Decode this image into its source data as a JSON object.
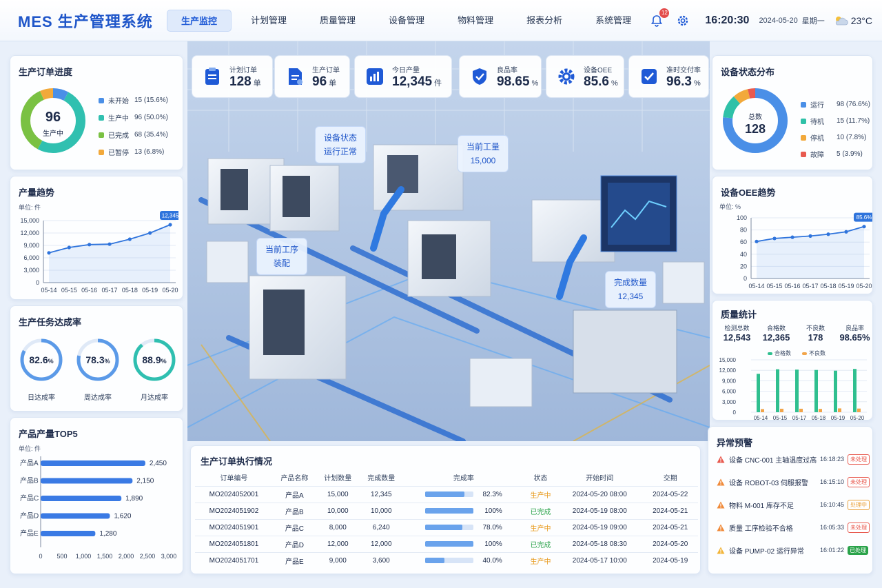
{
  "header": {
    "title": "MES 生产管理系统",
    "nav": [
      "生产监控",
      "计划管理",
      "质量管理",
      "设备管理",
      "物料管理",
      "报表分析",
      "系统管理"
    ],
    "active_index": 0,
    "notifications": "12",
    "time": "16:20:30",
    "date": "2024-05-20",
    "weekday": "星期一",
    "temperature": "23°C"
  },
  "kpis": [
    {
      "label": "计划订单",
      "value": "128",
      "unit": "单",
      "icon": "clipboard-icon"
    },
    {
      "label": "生产订单",
      "value": "96",
      "unit": "单",
      "icon": "document-icon"
    },
    {
      "label": "今日产量",
      "value": "12,345",
      "unit": "件",
      "icon": "bar-chart-icon"
    },
    {
      "label": "良品率",
      "value": "98.65",
      "unit": "%",
      "icon": "shield-check-icon"
    },
    {
      "label": "设备OEE",
      "value": "85.6",
      "unit": "%",
      "icon": "gear-icon"
    },
    {
      "label": "准时交付率",
      "value": "96.3",
      "unit": "%",
      "icon": "checkbox-icon"
    }
  ],
  "order_progress": {
    "title": "生产订单进度",
    "center_value": "96",
    "center_label": "生产中",
    "items": [
      {
        "label": "未开始",
        "text": "15 (15.6%)",
        "value": 15,
        "color": "#4a8fe7"
      },
      {
        "label": "生产中",
        "text": "96 (50.0%)",
        "value": 96,
        "color": "#30c0b0"
      },
      {
        "label": "已完成",
        "text": "68 (35.4%)",
        "value": 68,
        "color": "#7ac143"
      },
      {
        "label": "已暂停",
        "text": "13 (6.8%)",
        "value": 13,
        "color": "#f2a93b"
      }
    ]
  },
  "output_trend": {
    "title": "产量趋势",
    "unit": "单位: 件",
    "last_label": "12,345",
    "chart_data": {
      "type": "line",
      "x": [
        "05-14",
        "05-15",
        "05-16",
        "05-17",
        "05-18",
        "05-19",
        "05-20"
      ],
      "values": [
        7200,
        8500,
        9200,
        9300,
        10500,
        12000,
        14000
      ],
      "ylim": [
        0,
        15000
      ],
      "yticks": [
        "0",
        "3,000",
        "6,000",
        "9,000",
        "12,000",
        "15,000"
      ]
    }
  },
  "task_rate": {
    "title": "生产任务达成率",
    "items": [
      {
        "value": "82.6",
        "pct": 82.6,
        "label": "日达成率",
        "color": "#5b9ae8"
      },
      {
        "value": "78.3",
        "pct": 78.3,
        "label": "周达成率",
        "color": "#5b9ae8"
      },
      {
        "value": "88.9",
        "pct": 88.9,
        "label": "月达成率",
        "color": "#2fbfb0"
      }
    ]
  },
  "top5": {
    "title": "产品产量TOP5",
    "unit": "单位: 件",
    "chart_data": {
      "type": "bar",
      "categories": [
        "产品A",
        "产品B",
        "产品C",
        "产品D",
        "产品E"
      ],
      "values": [
        2450,
        2150,
        1890,
        1620,
        1280
      ],
      "labels": [
        "2,450",
        "2,150",
        "1,890",
        "1,620",
        "1,280"
      ],
      "xlim": [
        0,
        3000
      ],
      "xticks": [
        "0",
        "500",
        "1,000",
        "1,500",
        "2,000",
        "2,500",
        "3,000"
      ]
    }
  },
  "callouts": [
    {
      "line1": "设备状态",
      "line2": "运行正常"
    },
    {
      "line1": "当前工量",
      "line2": "15,000"
    },
    {
      "line1": "当前工序",
      "line2": "装配"
    },
    {
      "line1": "完成数量",
      "line2": "12,345"
    }
  ],
  "orders_table": {
    "title": "生产订单执行情况",
    "headers": [
      "订单编号",
      "产品名称",
      "计划数量",
      "完成数量",
      "完成率",
      "状态",
      "开始时间",
      "交期"
    ],
    "rows": [
      {
        "id": "MO2024052001",
        "product": "产品A",
        "plan": "15,000",
        "done": "12,345",
        "rate": "82.3%",
        "pct": 82.3,
        "status": "生产中",
        "start": "2024-05-20 08:00",
        "due": "2024-05-22"
      },
      {
        "id": "MO2024051902",
        "product": "产品B",
        "plan": "10,000",
        "done": "10,000",
        "rate": "100%",
        "pct": 100,
        "status": "已完成",
        "start": "2024-05-19 08:00",
        "due": "2024-05-21"
      },
      {
        "id": "MO2024051901",
        "product": "产品C",
        "plan": "8,000",
        "done": "6,240",
        "rate": "78.0%",
        "pct": 78,
        "status": "生产中",
        "start": "2024-05-19 09:00",
        "due": "2024-05-21"
      },
      {
        "id": "MO2024051801",
        "product": "产品D",
        "plan": "12,000",
        "done": "12,000",
        "rate": "100%",
        "pct": 100,
        "status": "已完成",
        "start": "2024-05-18 08:30",
        "due": "2024-05-20"
      },
      {
        "id": "MO2024051701",
        "product": "产品E",
        "plan": "9,000",
        "done": "3,600",
        "rate": "40.0%",
        "pct": 40,
        "status": "生产中",
        "start": "2024-05-17 10:00",
        "due": "2024-05-19"
      }
    ],
    "status_colors": {
      "生产中": "#e89a1c",
      "已完成": "#2aa34a"
    }
  },
  "equipment_status": {
    "title": "设备状态分布",
    "center_label": "总数",
    "center_value": "128",
    "items": [
      {
        "label": "运行",
        "text": "98 (76.6%)",
        "value": 98,
        "color": "#4a8fe7"
      },
      {
        "label": "待机",
        "text": "15 (11.7%)",
        "value": 15,
        "color": "#2fc1a8"
      },
      {
        "label": "停机",
        "text": "10 (7.8%)",
        "value": 10,
        "color": "#f2a93b"
      },
      {
        "label": "故障",
        "text": "5 (3.9%)",
        "value": 5,
        "color": "#e85a4f"
      }
    ]
  },
  "oee_trend": {
    "title": "设备OEE趋势",
    "unit": "单位: %",
    "last_label": "85.6%",
    "chart_data": {
      "type": "line",
      "x": [
        "05-14",
        "05-15",
        "05-16",
        "05-17",
        "05-18",
        "05-19",
        "05-20"
      ],
      "values": [
        61,
        66,
        68,
        70,
        73,
        77,
        85.6
      ],
      "ylim": [
        0,
        100
      ],
      "yticks": [
        "0",
        "20",
        "40",
        "60",
        "80",
        "100"
      ]
    }
  },
  "quality": {
    "title": "质量统计",
    "stats": [
      {
        "label": "检测总数",
        "value": "12,543"
      },
      {
        "label": "合格数",
        "value": "12,365"
      },
      {
        "label": "不良数",
        "value": "178"
      },
      {
        "label": "良品率",
        "value": "98.65%"
      }
    ],
    "legend": [
      "合格数",
      "不良数"
    ],
    "chart_data": {
      "type": "bar",
      "categories": [
        "05-14",
        "05-15",
        "05-17",
        "05-18",
        "05-19",
        "05-20"
      ],
      "series": [
        {
          "name": "合格数",
          "values": [
            11000,
            12300,
            12200,
            12100,
            11900,
            12400
          ],
          "color": "#2fbf8f"
        },
        {
          "name": "不良数",
          "values": [
            900,
            1000,
            1000,
            950,
            1100,
            1050
          ],
          "color": "#f2a54a"
        }
      ],
      "ylim": [
        0,
        15000
      ],
      "yticks": [
        "0",
        "3,000",
        "6,000",
        "9,000",
        "12,000",
        "15,000"
      ]
    }
  },
  "alerts": {
    "title": "异常预警",
    "items": [
      {
        "text": "设备 CNC-001 主轴温度过高",
        "time": "16:18:23",
        "status": "未处理",
        "level": "red"
      },
      {
        "text": "设备 ROBOT-03 伺服报警",
        "time": "16:15:10",
        "status": "未处理",
        "level": "orange"
      },
      {
        "text": "物料 M-001 库存不足",
        "time": "16:10:45",
        "status": "处理中",
        "level": "orange"
      },
      {
        "text": "质量 工序检验不合格",
        "time": "16:05:33",
        "status": "未处理",
        "level": "orange"
      },
      {
        "text": "设备 PUMP-02 运行异常",
        "time": "16:01:22",
        "status": "已处理",
        "level": "yellow"
      }
    ],
    "status_colors": {
      "未处理": "#e85a4f",
      "处理中": "#e8a03a",
      "已处理": "#2aa34a"
    },
    "level_colors": {
      "red": "#e85a4f",
      "orange": "#f08a3a",
      "yellow": "#f2b53a"
    }
  }
}
